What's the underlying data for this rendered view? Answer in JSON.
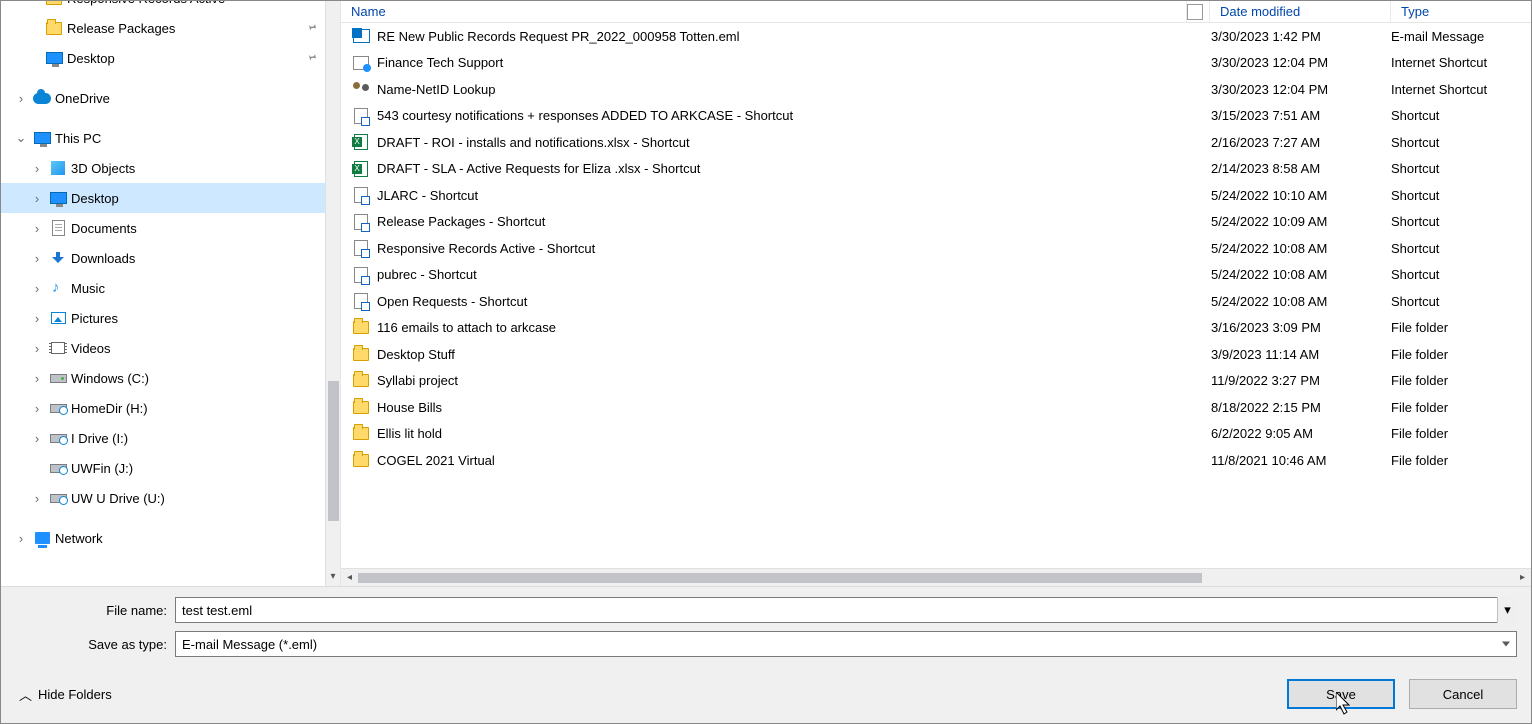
{
  "columns": {
    "name": "Name",
    "date": "Date modified",
    "type": "Type"
  },
  "quick_access": [
    {
      "label": "Responsive Records Active",
      "icon": "folder",
      "pinned": true,
      "indent": 44
    },
    {
      "label": "Release Packages",
      "icon": "folder",
      "pinned": true,
      "indent": 44
    },
    {
      "label": "Desktop",
      "icon": "monitor",
      "pinned": true,
      "indent": 44
    }
  ],
  "tree": [
    {
      "label": "OneDrive",
      "icon": "cloud",
      "chev": "right",
      "indent": 12,
      "chevVisible": true
    },
    {
      "label": "This PC",
      "icon": "monitor",
      "chev": "down",
      "indent": 12,
      "chevVisible": true
    },
    {
      "label": "3D Objects",
      "icon": "cube",
      "chev": "right",
      "indent": 28,
      "chevVisible": true
    },
    {
      "label": "Desktop",
      "icon": "monitor",
      "chev": "right",
      "indent": 28,
      "chevVisible": true,
      "selected": true
    },
    {
      "label": "Documents",
      "icon": "doc",
      "chev": "right",
      "indent": 28,
      "chevVisible": true
    },
    {
      "label": "Downloads",
      "icon": "dl",
      "chev": "right",
      "indent": 28,
      "chevVisible": true
    },
    {
      "label": "Music",
      "icon": "note",
      "chev": "right",
      "indent": 28,
      "chevVisible": true
    },
    {
      "label": "Pictures",
      "icon": "pic",
      "chev": "right",
      "indent": 28,
      "chevVisible": true
    },
    {
      "label": "Videos",
      "icon": "vid",
      "chev": "right",
      "indent": 28,
      "chevVisible": true
    },
    {
      "label": "Windows (C:)",
      "icon": "drive",
      "chev": "right",
      "indent": 28,
      "chevVisible": true
    },
    {
      "label": "HomeDir (H:)",
      "icon": "netdrive",
      "chev": "right",
      "indent": 28,
      "chevVisible": true
    },
    {
      "label": "I Drive (I:)",
      "icon": "netdrive",
      "chev": "right",
      "indent": 28,
      "chevVisible": true
    },
    {
      "label": "UWFin (J:)",
      "icon": "netdrive",
      "chev": "right",
      "indent": 28,
      "chevVisible": false
    },
    {
      "label": "UW U Drive (U:)",
      "icon": "netdrive",
      "chev": "right",
      "indent": 28,
      "chevVisible": true
    },
    {
      "label": "Network",
      "icon": "net",
      "chev": "right",
      "indent": 12,
      "chevVisible": true
    }
  ],
  "files": [
    {
      "name": "RE New Public Records Request PR_2022_000958 Totten.eml",
      "date": "3/30/2023 1:42 PM",
      "type": "E-mail Message",
      "icon": "eml"
    },
    {
      "name": "Finance Tech Support",
      "date": "3/30/2023 12:04 PM",
      "type": "Internet Shortcut",
      "icon": "webSc"
    },
    {
      "name": "Name-NetID Lookup",
      "date": "3/30/2023 12:04 PM",
      "type": "Internet Shortcut",
      "icon": "ppl"
    },
    {
      "name": "543 courtesy notifications + responses ADDED TO ARKCASE - Shortcut",
      "date": "3/15/2023 7:51 AM",
      "type": "Shortcut",
      "icon": "lnk"
    },
    {
      "name": "DRAFT - ROI - installs and notifications.xlsx - Shortcut",
      "date": "2/16/2023 7:27 AM",
      "type": "Shortcut",
      "icon": "xls"
    },
    {
      "name": "DRAFT - SLA - Active Requests for Eliza .xlsx - Shortcut",
      "date": "2/14/2023 8:58 AM",
      "type": "Shortcut",
      "icon": "xls"
    },
    {
      "name": "JLARC - Shortcut",
      "date": "5/24/2022 10:10 AM",
      "type": "Shortcut",
      "icon": "lnk"
    },
    {
      "name": "Release Packages - Shortcut",
      "date": "5/24/2022 10:09 AM",
      "type": "Shortcut",
      "icon": "lnk"
    },
    {
      "name": "Responsive Records Active - Shortcut",
      "date": "5/24/2022 10:08 AM",
      "type": "Shortcut",
      "icon": "lnk"
    },
    {
      "name": "pubrec - Shortcut",
      "date": "5/24/2022 10:08 AM",
      "type": "Shortcut",
      "icon": "lnk"
    },
    {
      "name": "Open Requests - Shortcut",
      "date": "5/24/2022 10:08 AM",
      "type": "Shortcut",
      "icon": "lnk"
    },
    {
      "name": "116 emails to attach to arkcase",
      "date": "3/16/2023 3:09 PM",
      "type": "File folder",
      "icon": "folder"
    },
    {
      "name": "Desktop Stuff",
      "date": "3/9/2023 11:14 AM",
      "type": "File folder",
      "icon": "folder"
    },
    {
      "name": "Syllabi project",
      "date": "11/9/2022 3:27 PM",
      "type": "File folder",
      "icon": "folder"
    },
    {
      "name": "House Bills",
      "date": "8/18/2022 2:15 PM",
      "type": "File folder",
      "icon": "folder"
    },
    {
      "name": "Ellis lit hold",
      "date": "6/2/2022 9:05 AM",
      "type": "File folder",
      "icon": "folder"
    },
    {
      "name": "COGEL 2021 Virtual",
      "date": "11/8/2021 10:46 AM",
      "type": "File folder",
      "icon": "folder"
    }
  ],
  "form": {
    "filename_label": "File name:",
    "filename_value": "test test.eml",
    "savetype_label": "Save as type:",
    "savetype_value": "E-mail Message (*.eml)"
  },
  "actions": {
    "hide_folders": "Hide Folders",
    "save": "Save",
    "cancel": "Cancel"
  }
}
